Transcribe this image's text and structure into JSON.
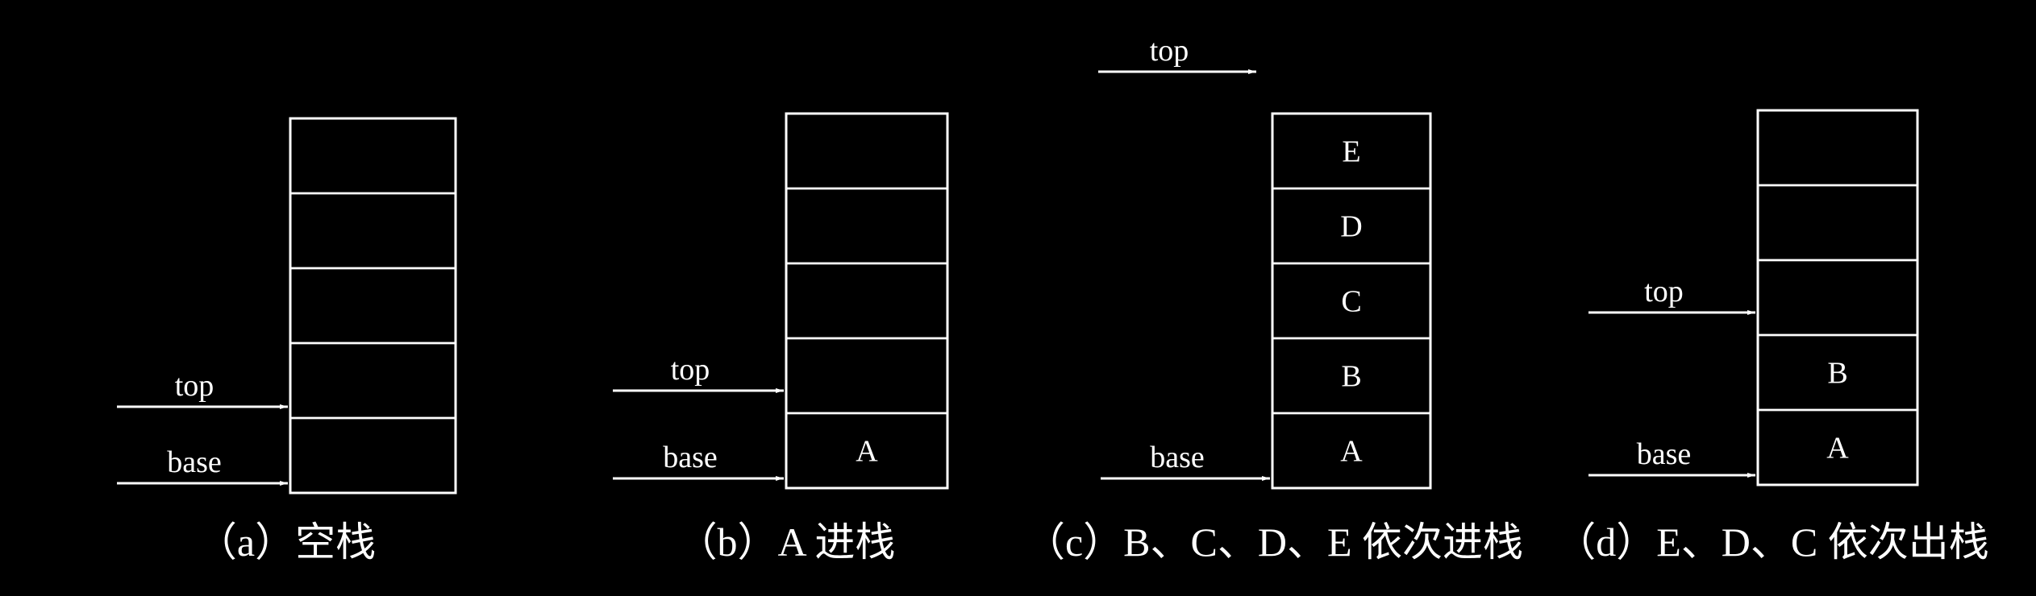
{
  "colors": {
    "background": "#000000",
    "stroke": "#ffffff",
    "text": "#ffffff"
  },
  "diagrams": [
    {
      "id": "a",
      "caption": "（a）空栈",
      "cells": [
        "",
        "",
        "",
        "",
        ""
      ],
      "pointers": [
        {
          "label": "top",
          "cell_index": 0
        },
        {
          "label": "base",
          "cell_index": 0
        }
      ]
    },
    {
      "id": "b",
      "caption": "（b）A 进栈",
      "cells": [
        "A",
        "",
        "",
        "",
        ""
      ],
      "pointers": [
        {
          "label": "top",
          "cell_index": 1
        },
        {
          "label": "base",
          "cell_index": 0
        }
      ]
    },
    {
      "id": "c",
      "caption": "（c）B、C、D、E 依次进栈",
      "cells": [
        "A",
        "B",
        "C",
        "D",
        "E"
      ],
      "pointers": [
        {
          "label": "top",
          "cell_index": 5
        },
        {
          "label": "base",
          "cell_index": 0
        }
      ]
    },
    {
      "id": "d",
      "caption": "（d）E、D、C 依次出栈",
      "cells": [
        "A",
        "B",
        "",
        "",
        ""
      ],
      "pointers": [
        {
          "label": "top",
          "cell_index": 2
        },
        {
          "label": "base",
          "cell_index": 0
        }
      ]
    }
  ]
}
